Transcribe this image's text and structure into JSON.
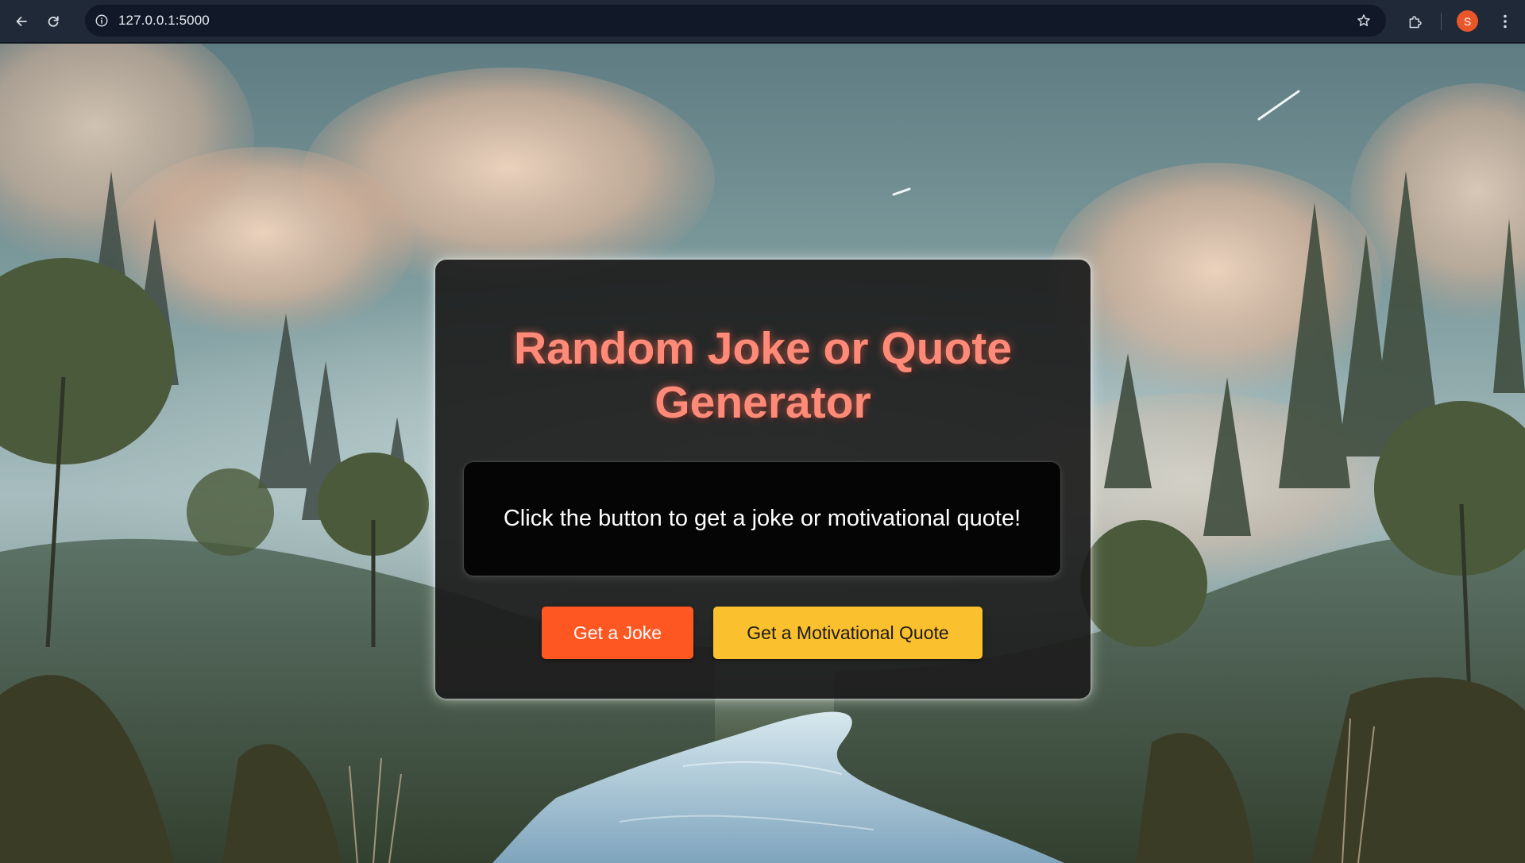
{
  "browser": {
    "url": "127.0.0.1:5000",
    "profile_initial": "S",
    "icons": {
      "back": "arrow-left-icon",
      "reload": "reload-icon",
      "site_info": "info-icon",
      "bookmark": "star-icon",
      "extensions": "puzzle-icon",
      "menu": "more-vert-icon"
    },
    "colors": {
      "toolbar": "#1f2937",
      "omnibox": "#111827",
      "profile": "#e8562a"
    }
  },
  "page": {
    "title_line1": "Random Joke or Quote",
    "title_line2": "Generator",
    "message": "Click the button to get a joke or motivational quote!",
    "buttons": {
      "joke_label": "Get a Joke",
      "quote_label": "Get a Motivational Quote"
    },
    "colors": {
      "title": "#ff8a78",
      "card": "#1c1c1c",
      "message_box": "#050505",
      "joke_button": "#ff5722",
      "quote_button": "#fbc02d"
    }
  }
}
